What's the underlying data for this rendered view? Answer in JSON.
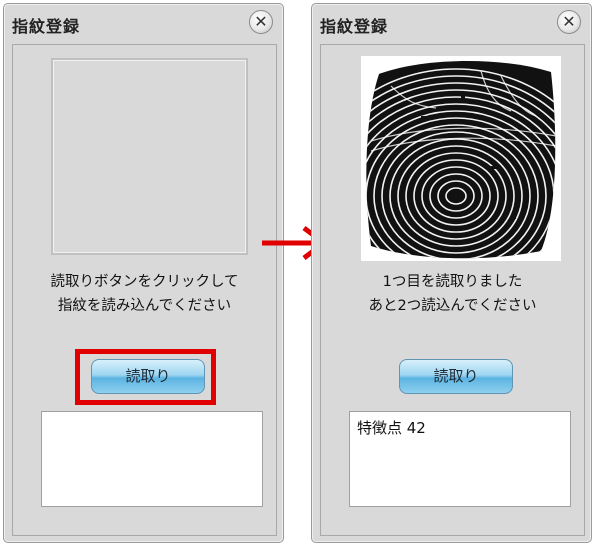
{
  "left_dialog": {
    "title": "指紋登録",
    "message_line1": "読取りボタンをクリックして",
    "message_line2": "指紋を読み込んでください",
    "read_button": "読取り",
    "result_text": ""
  },
  "right_dialog": {
    "title": "指紋登録",
    "message_line1": "1つ目を読取りました",
    "message_line2": "あと2つ読込んでください",
    "read_button": "読取り",
    "result_text": "特徴点 42"
  },
  "icons": {
    "close": "close-icon",
    "arrow": "arrow-right-icon"
  },
  "colors": {
    "highlight": "#e00000",
    "arrow": "#e00000",
    "button": "#7cc4ea"
  }
}
